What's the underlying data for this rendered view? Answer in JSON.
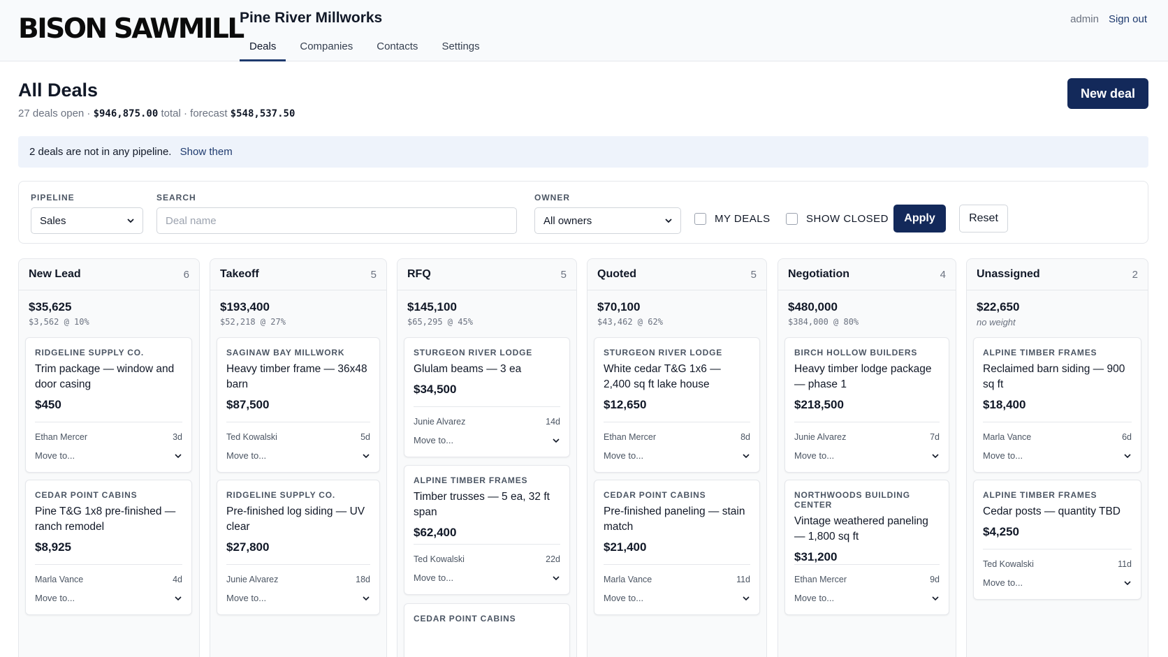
{
  "brand": "BISON SAWMILL",
  "org_name": "Pine River Millworks",
  "nav": [
    "Deals",
    "Companies",
    "Contacts",
    "Settings"
  ],
  "user": {
    "name": "admin",
    "signout": "Sign out"
  },
  "page": {
    "title": "All Deals",
    "summary_open": "27 deals open · ",
    "summary_total": "$946,875.00",
    "summary_total_label": " total · forecast ",
    "summary_forecast": "$548,537.50",
    "new_deal_label": "New deal"
  },
  "notice": {
    "text": "2 deals are not in any pipeline.",
    "link": "Show them"
  },
  "filters": {
    "pipeline_label": "PIPELINE",
    "pipeline_value": "Sales",
    "search_label": "SEARCH",
    "search_placeholder": "Deal name",
    "owner_label": "OWNER",
    "owner_value": "All owners",
    "my_deals_label": "MY DEALS",
    "show_closed_label": "SHOW CLOSED",
    "apply_label": "Apply",
    "reset_label": "Reset"
  },
  "columns": [
    {
      "name": "New Lead",
      "count": "6",
      "total": "$35,625",
      "forecast": "$3,562 @ 10%",
      "cards": [
        {
          "company": "RIDGELINE SUPPLY CO.",
          "title": "Trim package — window and door casing",
          "value": "$450",
          "owner": "Ethan Mercer",
          "age": "3d",
          "move": "Move to..."
        },
        {
          "company": "CEDAR POINT CABINS",
          "title": "Pine T&G 1x8 pre-finished — ranch remodel",
          "value": "$8,925",
          "owner": "Marla Vance",
          "age": "4d",
          "move": "Move to..."
        }
      ]
    },
    {
      "name": "Takeoff",
      "count": "5",
      "total": "$193,400",
      "forecast": "$52,218 @ 27%",
      "cards": [
        {
          "company": "SAGINAW BAY MILLWORK",
          "title": "Heavy timber frame — 36x48 barn",
          "value": "$87,500",
          "owner": "Ted Kowalski",
          "age": "5d",
          "move": "Move to..."
        },
        {
          "company": "RIDGELINE SUPPLY CO.",
          "title": "Pre-finished log siding — UV clear",
          "value": "$27,800",
          "owner": "Junie Alvarez",
          "age": "18d",
          "move": "Move to..."
        }
      ]
    },
    {
      "name": "RFQ",
      "count": "5",
      "total": "$145,100",
      "forecast": "$65,295 @ 45%",
      "cards": [
        {
          "company": "STURGEON RIVER LODGE",
          "title": "Glulam beams — 3 ea",
          "value": "$34,500",
          "owner": "Junie Alvarez",
          "age": "14d",
          "move": "Move to..."
        },
        {
          "company": "ALPINE TIMBER FRAMES",
          "title": "Timber trusses — 5 ea, 32 ft span",
          "value": "$62,400",
          "owner": "Ted Kowalski",
          "age": "22d",
          "move": "Move to..."
        },
        {
          "company": "CEDAR POINT CABINS",
          "title": "",
          "value": "",
          "owner": "",
          "age": "",
          "move": ""
        }
      ]
    },
    {
      "name": "Quoted",
      "count": "5",
      "total": "$70,100",
      "forecast": "$43,462 @ 62%",
      "cards": [
        {
          "company": "STURGEON RIVER LODGE",
          "title": "White cedar T&G 1x6 — 2,400 sq ft lake house",
          "value": "$12,650",
          "owner": "Ethan Mercer",
          "age": "8d",
          "move": "Move to..."
        },
        {
          "company": "CEDAR POINT CABINS",
          "title": "Pre-finished paneling — stain match",
          "value": "$21,400",
          "owner": "Marla Vance",
          "age": "11d",
          "move": "Move to..."
        }
      ]
    },
    {
      "name": "Negotiation",
      "count": "4",
      "total": "$480,000",
      "forecast": "$384,000 @ 80%",
      "cards": [
        {
          "company": "BIRCH HOLLOW BUILDERS",
          "title": "Heavy timber lodge package — phase 1",
          "value": "$218,500",
          "owner": "Junie Alvarez",
          "age": "7d",
          "move": "Move to..."
        },
        {
          "company": "NORTHWOODS BUILDING CENTER",
          "title": "Vintage weathered paneling — 1,800 sq ft",
          "value": "$31,200",
          "owner": "Ethan Mercer",
          "age": "9d",
          "move": "Move to..."
        }
      ]
    },
    {
      "name": "Unassigned",
      "count": "2",
      "total": "$22,650",
      "forecast": "no weight",
      "cards": [
        {
          "company": "ALPINE TIMBER FRAMES",
          "title": "Reclaimed barn siding — 900 sq ft",
          "value": "$18,400",
          "owner": "Marla Vance",
          "age": "6d",
          "move": "Move to..."
        },
        {
          "company": "ALPINE TIMBER FRAMES",
          "title": "Cedar posts — quantity TBD",
          "value": "$4,250",
          "owner": "Ted Kowalski",
          "age": "11d",
          "move": "Move to..."
        }
      ]
    }
  ]
}
